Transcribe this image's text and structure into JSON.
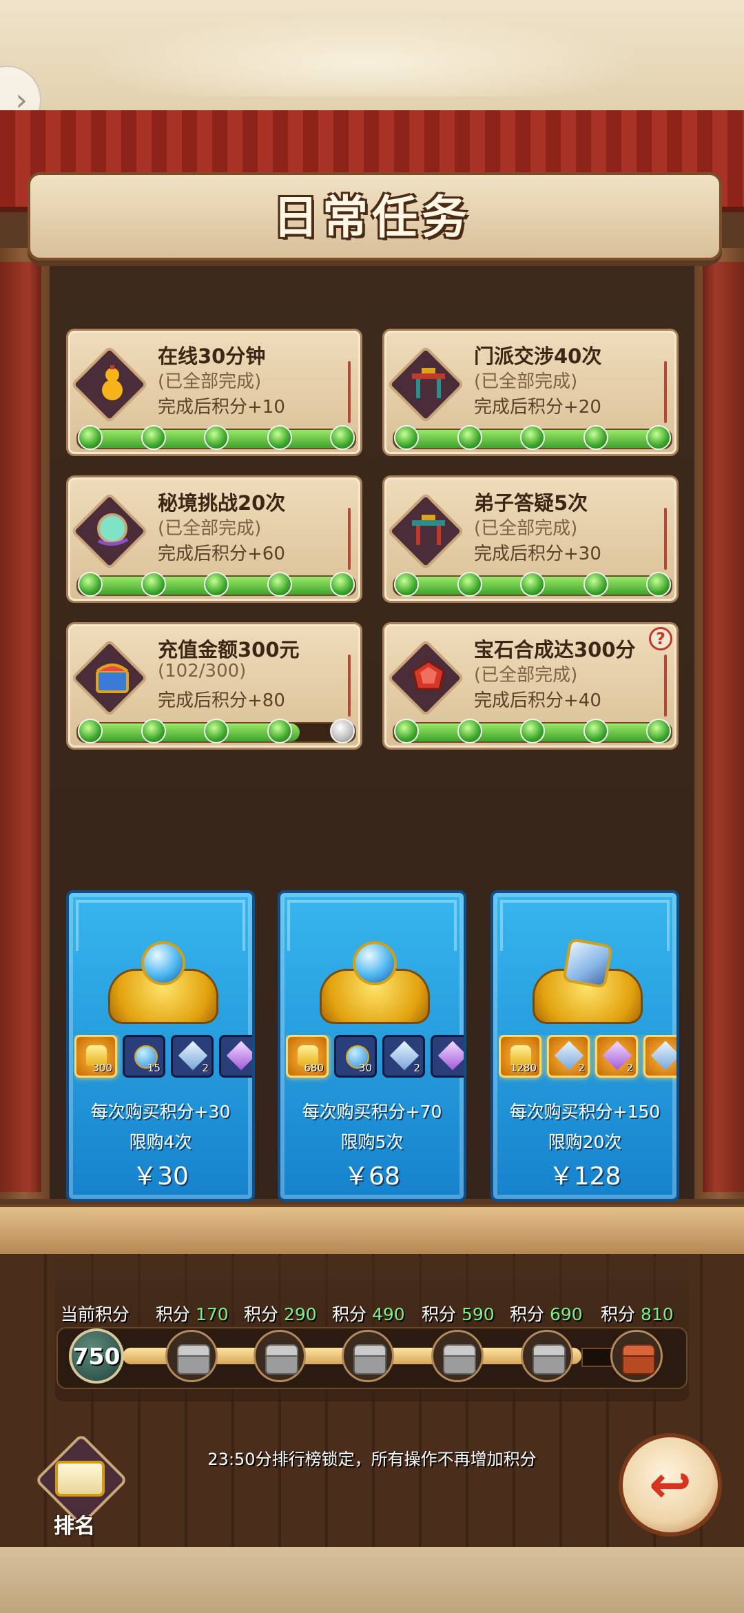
{
  "title": "日常任务",
  "tasks": [
    {
      "name": "在线30分钟",
      "status": "(已全部完成)",
      "reward": "完成后积分+10",
      "icon": "gourd-icon",
      "progress": 1.0
    },
    {
      "name": "门派交涉40次",
      "status": "(已全部完成)",
      "reward": "完成后积分+20",
      "icon": "gate-icon",
      "progress": 1.0
    },
    {
      "name": "秘境挑战20次",
      "status": "(已全部完成)",
      "reward": "完成后积分+60",
      "icon": "mirror-icon",
      "progress": 1.0
    },
    {
      "name": "弟子答疑5次",
      "status": "(已全部完成)",
      "reward": "完成后积分+30",
      "icon": "gate-icon",
      "progress": 1.0
    },
    {
      "name": "充值金额300元",
      "status": "(102/300)",
      "reward": "完成后积分+80",
      "icon": "treasure-box-icon",
      "progress": 0.8
    },
    {
      "name": "宝石合成达300分",
      "status": "(已全部完成)",
      "reward": "完成后积分+40",
      "icon": "gem-icon",
      "progress": 1.0
    }
  ],
  "packs": [
    {
      "items": [
        {
          "icon": "gold-ingot-icon",
          "count": "300"
        },
        {
          "icon": "orb-icon",
          "count": "15"
        },
        {
          "icon": "crystal-icon",
          "count": "2"
        }
      ],
      "desc": "每次购买积分+30",
      "limit": "限购4次",
      "price": "￥30"
    },
    {
      "items": [
        {
          "icon": "gold-ingot-icon",
          "count": "680"
        },
        {
          "icon": "orb-icon",
          "count": "30"
        },
        {
          "icon": "crystal-icon",
          "count": "2"
        }
      ],
      "desc": "每次购买积分+70",
      "limit": "限购5次",
      "price": "￥68"
    },
    {
      "items": [
        {
          "icon": "gold-ingot-icon",
          "count": "1280"
        },
        {
          "icon": "crystal-icon",
          "count": "2"
        },
        {
          "icon": "purple-crystal-icon",
          "count": "2"
        }
      ],
      "desc": "每次购买积分+150",
      "limit": "限购20次",
      "price": "￥128"
    }
  ],
  "points": {
    "current_label": "当前积分",
    "current_value": "750",
    "milestone_prefix": "积分",
    "milestones": [
      "170",
      "290",
      "490",
      "590",
      "690",
      "810"
    ]
  },
  "notice": "23:50分排行榜锁定，所有操作不再增加积分",
  "rank_label": "排名",
  "colors": {
    "accent_green": "#7df083",
    "curtain_red": "#a83225",
    "pack_blue": "#1682cc"
  }
}
